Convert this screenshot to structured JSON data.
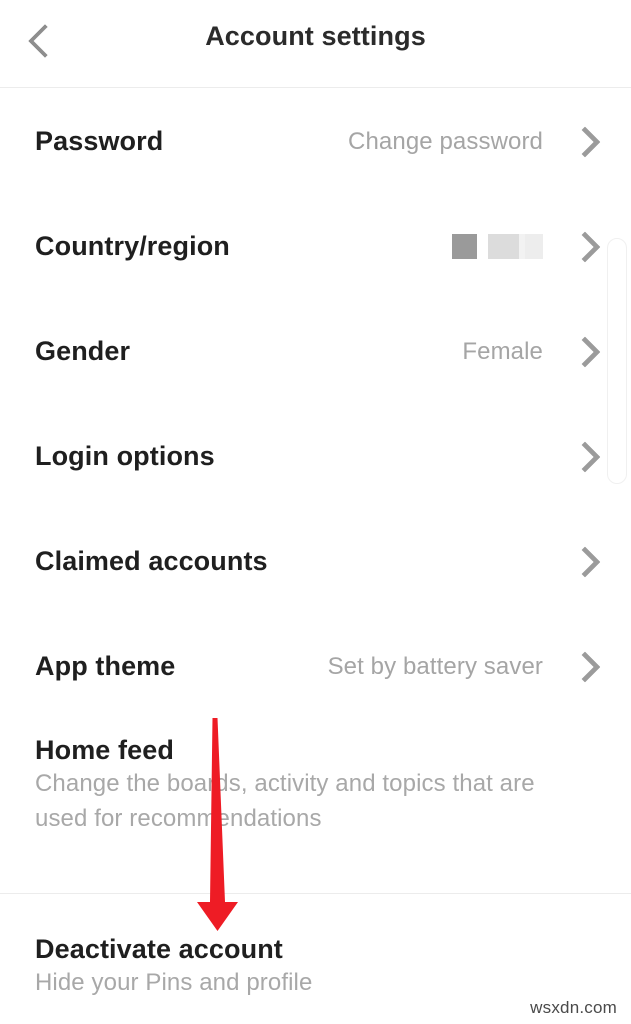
{
  "header": {
    "back_icon": "chevron-left-icon",
    "title": "Account settings"
  },
  "settings_rows": [
    {
      "label": "Password",
      "value": "Change password",
      "chevron": "chevron-right-icon",
      "redacted": false
    },
    {
      "label": "Country/region",
      "value": "",
      "chevron": "chevron-right-icon",
      "redacted": true
    },
    {
      "label": "Gender",
      "value": "Female",
      "chevron": "chevron-right-icon",
      "redacted": false
    },
    {
      "label": "Login options",
      "value": "",
      "chevron": "chevron-right-icon",
      "redacted": false
    },
    {
      "label": "Claimed accounts",
      "value": "",
      "chevron": "chevron-right-icon",
      "redacted": false
    },
    {
      "label": "App theme",
      "value": "Set by battery saver",
      "chevron": "chevron-right-icon",
      "redacted": false
    }
  ],
  "home_feed": {
    "title": "Home feed",
    "description": "Change the boards, activity and topics that are used for recommendations"
  },
  "deactivate": {
    "title": "Deactivate account",
    "description": "Hide your Pins and profile"
  },
  "annotation": {
    "arrow_color": "#ee1c25",
    "arrow_name": "red-down-arrow"
  },
  "watermark": "wsxdn.com"
}
